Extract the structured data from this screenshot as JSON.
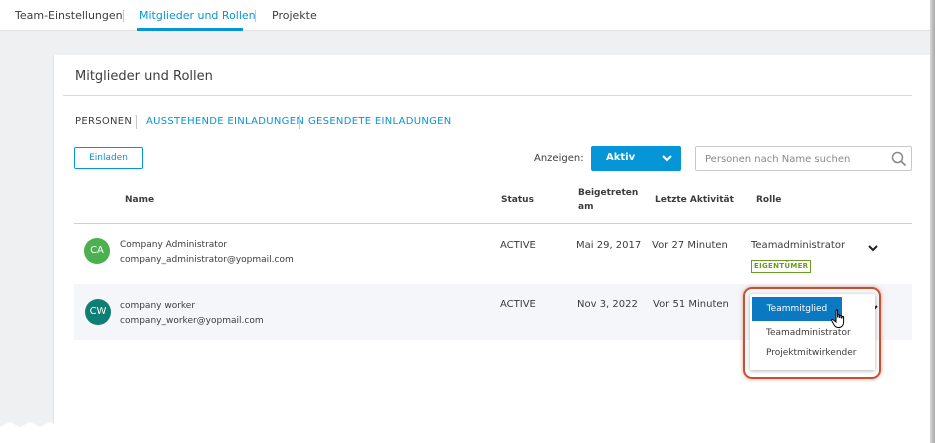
{
  "top_tabs": [
    {
      "label": "Team-Einstellungen",
      "active": false
    },
    {
      "label": "Mitglieder und Rollen",
      "active": true
    },
    {
      "label": "Projekte",
      "active": false
    }
  ],
  "panel": {
    "title": "Mitglieder und Rollen",
    "subtabs": [
      {
        "label": "PERSONEN",
        "active": true
      },
      {
        "label": "AUSSTEHENDE EINLADUNGEN",
        "active": false
      },
      {
        "label": "GESENDETE EINLADUNGEN",
        "active": false
      }
    ],
    "invite_label": "Einladen",
    "show_label": "Anzeigen:",
    "show_value": "Aktiv",
    "search_placeholder": "Personen nach Name suchen"
  },
  "table": {
    "headers": {
      "name": "Name",
      "status": "Status",
      "joined_line1": "Beigetreten",
      "joined_line2": "am",
      "last_activity": "Letzte Aktivität",
      "role": "Rolle"
    },
    "rows": [
      {
        "initials": "CA",
        "name": "Company Administrator",
        "email": "company_administrator@yopmail.com",
        "status": "ACTIVE",
        "joined": "Mai 29, 2017",
        "last_activity": "Vor 27 Minuten",
        "role": "Teamadministrator",
        "badge": "EIGENTÜMER",
        "avatar_color": "#4caf50"
      },
      {
        "initials": "CW",
        "name": "company worker",
        "email": "company_worker@yopmail.com",
        "status": "ACTIVE",
        "joined": "Nov 3, 2022",
        "last_activity": "Vor 51 Minuten",
        "avatar_color": "#0f7f76"
      }
    ]
  },
  "role_menu": {
    "selected": "Teammitglied",
    "options": [
      "Teamadministrator",
      "Projektmitwirkender"
    ]
  },
  "colors": {
    "accent": "#0696d7",
    "highlight": "#c6502f",
    "owner_badge": "#6a9a1f"
  }
}
